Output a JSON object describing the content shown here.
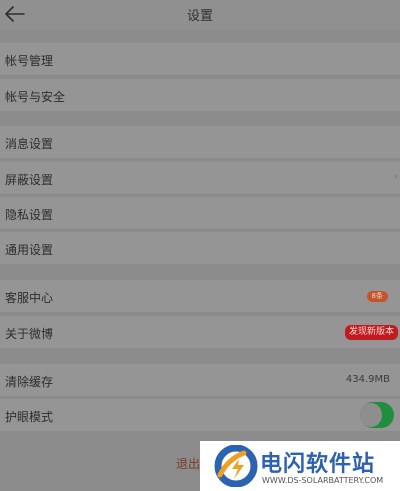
{
  "header": {
    "title": "设置"
  },
  "groups": {
    "account": {
      "manage": "帐号管理",
      "security": "帐号与安全"
    },
    "settings": {
      "message": "消息设置",
      "block": "屏蔽设置",
      "privacy": "隐私设置",
      "general": "通用设置"
    },
    "help": {
      "service": "客服中心",
      "service_badge": "8条",
      "about": "关于微博",
      "about_badge": "发现新版本"
    },
    "misc": {
      "clear_cache": "清除缓存",
      "cache_size": "434.9MB",
      "eye_care": "护眼模式",
      "eye_care_on": true
    }
  },
  "logout": {
    "label": "退出"
  },
  "watermark": {
    "title": "电闪软件站",
    "subtitle": "WWW.DS-SOLARBATTERY.COM"
  },
  "colors": {
    "toggle_on": "#1f8e3f",
    "badge_red": "#c01b1e",
    "brand_blue": "#2b63b0"
  }
}
